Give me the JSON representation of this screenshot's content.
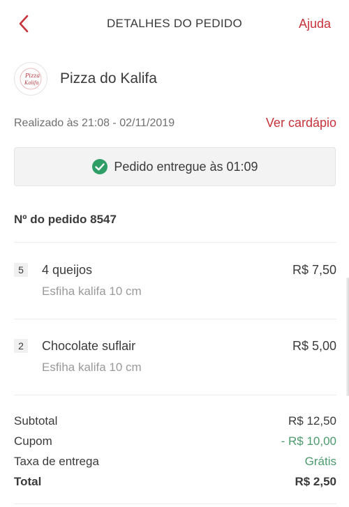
{
  "header": {
    "title": "DETALHES DO PEDIDO",
    "help_label": "Ajuda"
  },
  "store": {
    "name": "Pizza do Kalifa",
    "logo_text_1": "Pizza",
    "logo_text_2": "Kalifa"
  },
  "order": {
    "placed_at": "Realizado às 21:08 - 02/11/2019",
    "menu_link": "Ver cardápio",
    "status": "Pedido entregue às 01:09",
    "number": "Nº do pedido 8547"
  },
  "items": [
    {
      "qty": "5",
      "name": "4 queijos",
      "description": "Esfiha kalifa 10 cm",
      "price": "R$ 7,50"
    },
    {
      "qty": "2",
      "name": "Chocolate suflair",
      "description": "Esfiha kalifa 10 cm",
      "price": "R$ 5,00"
    }
  ],
  "summary": {
    "subtotal_label": "Subtotal",
    "subtotal_value": "R$ 12,50",
    "coupon_label": "Cupom",
    "coupon_value": "- R$ 10,00",
    "delivery_label": "Taxa de entrega",
    "delivery_value": "Grátis",
    "total_label": "Total",
    "total_value": "R$ 2,50"
  },
  "colors": {
    "accent": "#c8323a",
    "success": "#2e9e66",
    "discount": "#4c9a6e"
  },
  "icons": {
    "back": "chevron-left-icon",
    "status": "check-circle-icon"
  }
}
